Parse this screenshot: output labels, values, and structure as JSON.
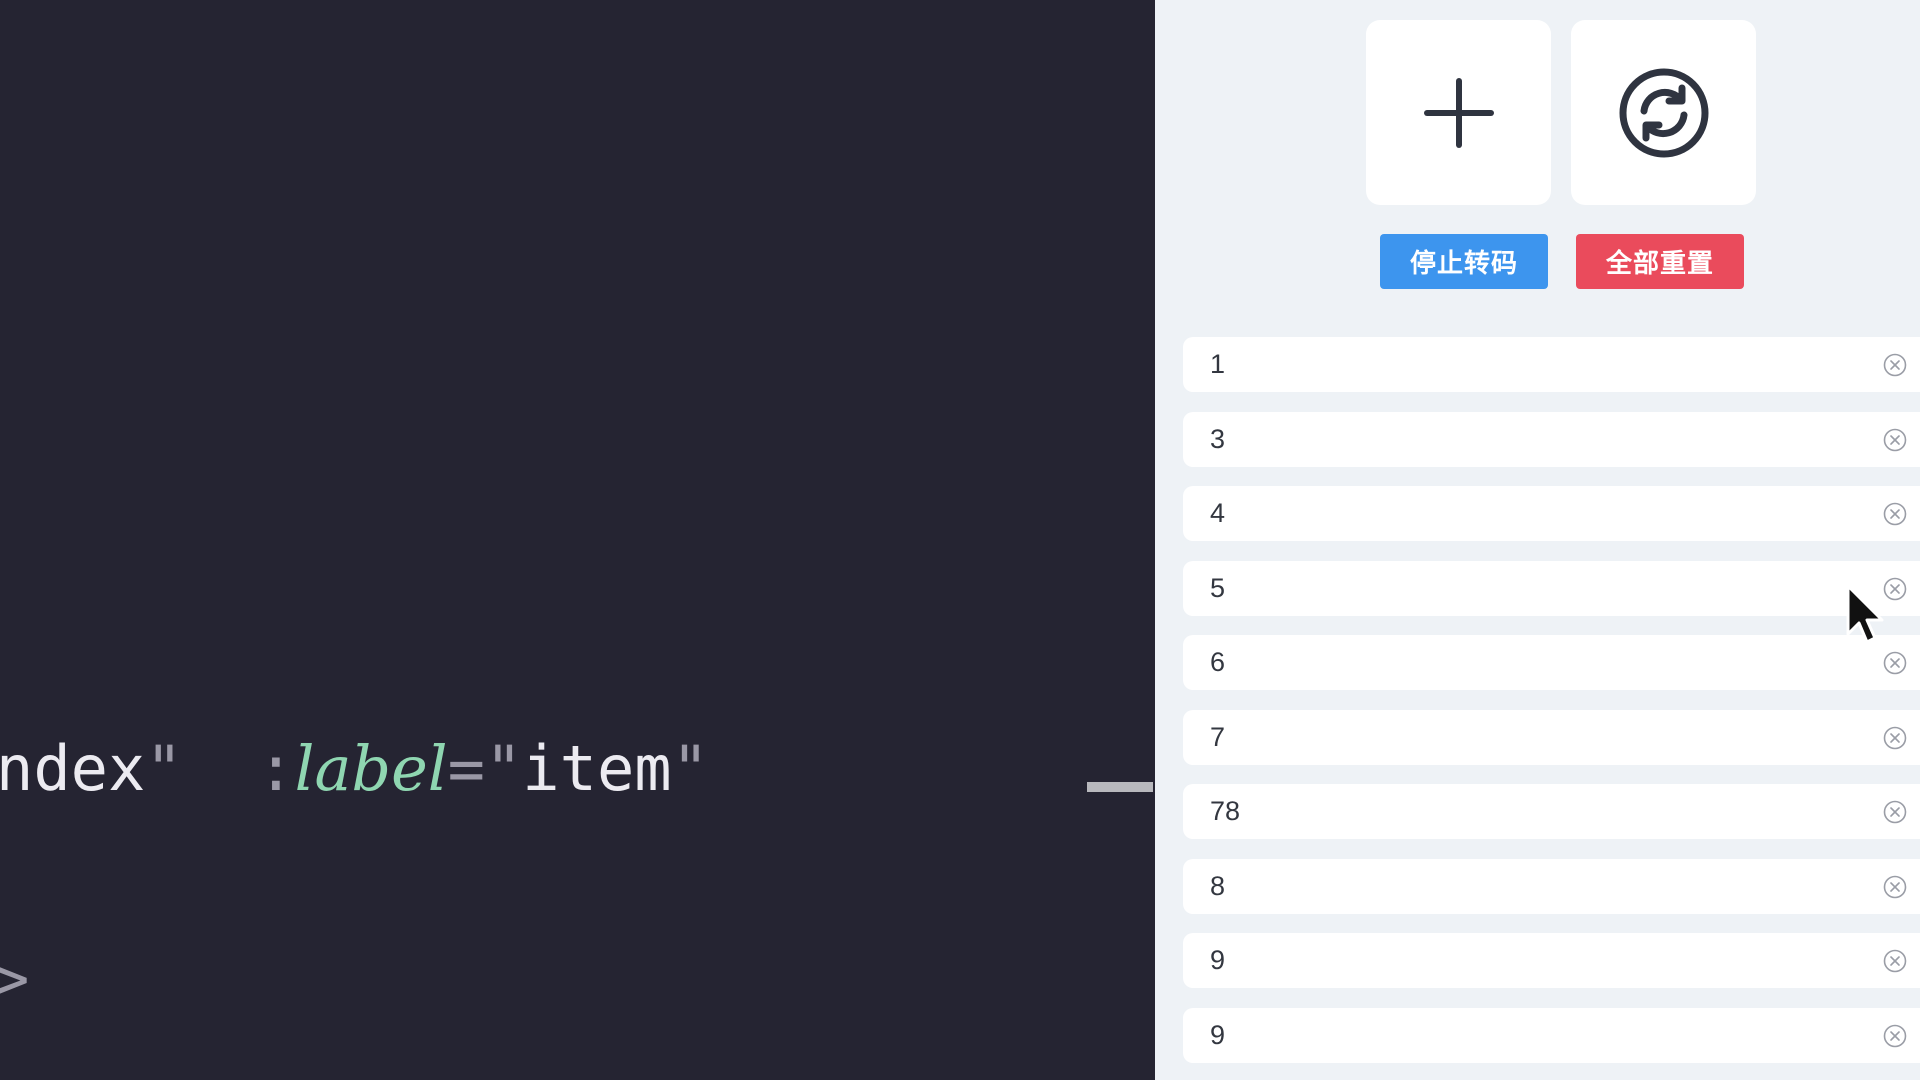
{
  "editor": {
    "line1": {
      "t1": "ndex",
      "q1": "\"",
      "gap": "  ",
      "colon": ":",
      "attr": "label",
      "eq": "=",
      "q2": "\"",
      "value": "item",
      "q3": "\""
    },
    "line2": {
      "punct": ">"
    },
    "colors": {
      "background": "#252432",
      "attribute": "#8fd6b1"
    }
  },
  "panel": {
    "add_tile_icon": "plus-icon",
    "reset_tile_icon": "refresh-circle-icon",
    "stop_button_label": "停止转码",
    "reset_all_button_label": "全部重置",
    "colors": {
      "background": "#eef2f6",
      "stop_button": "#3d95ee",
      "reset_all_button": "#ea4b5c"
    },
    "items": [
      {
        "label": "1"
      },
      {
        "label": "3"
      },
      {
        "label": "4"
      },
      {
        "label": "5"
      },
      {
        "label": "6"
      },
      {
        "label": "7"
      },
      {
        "label": "78"
      },
      {
        "label": "8"
      },
      {
        "label": "9"
      },
      {
        "label": "9"
      }
    ],
    "item_close_icon": "close-circle-icon"
  }
}
